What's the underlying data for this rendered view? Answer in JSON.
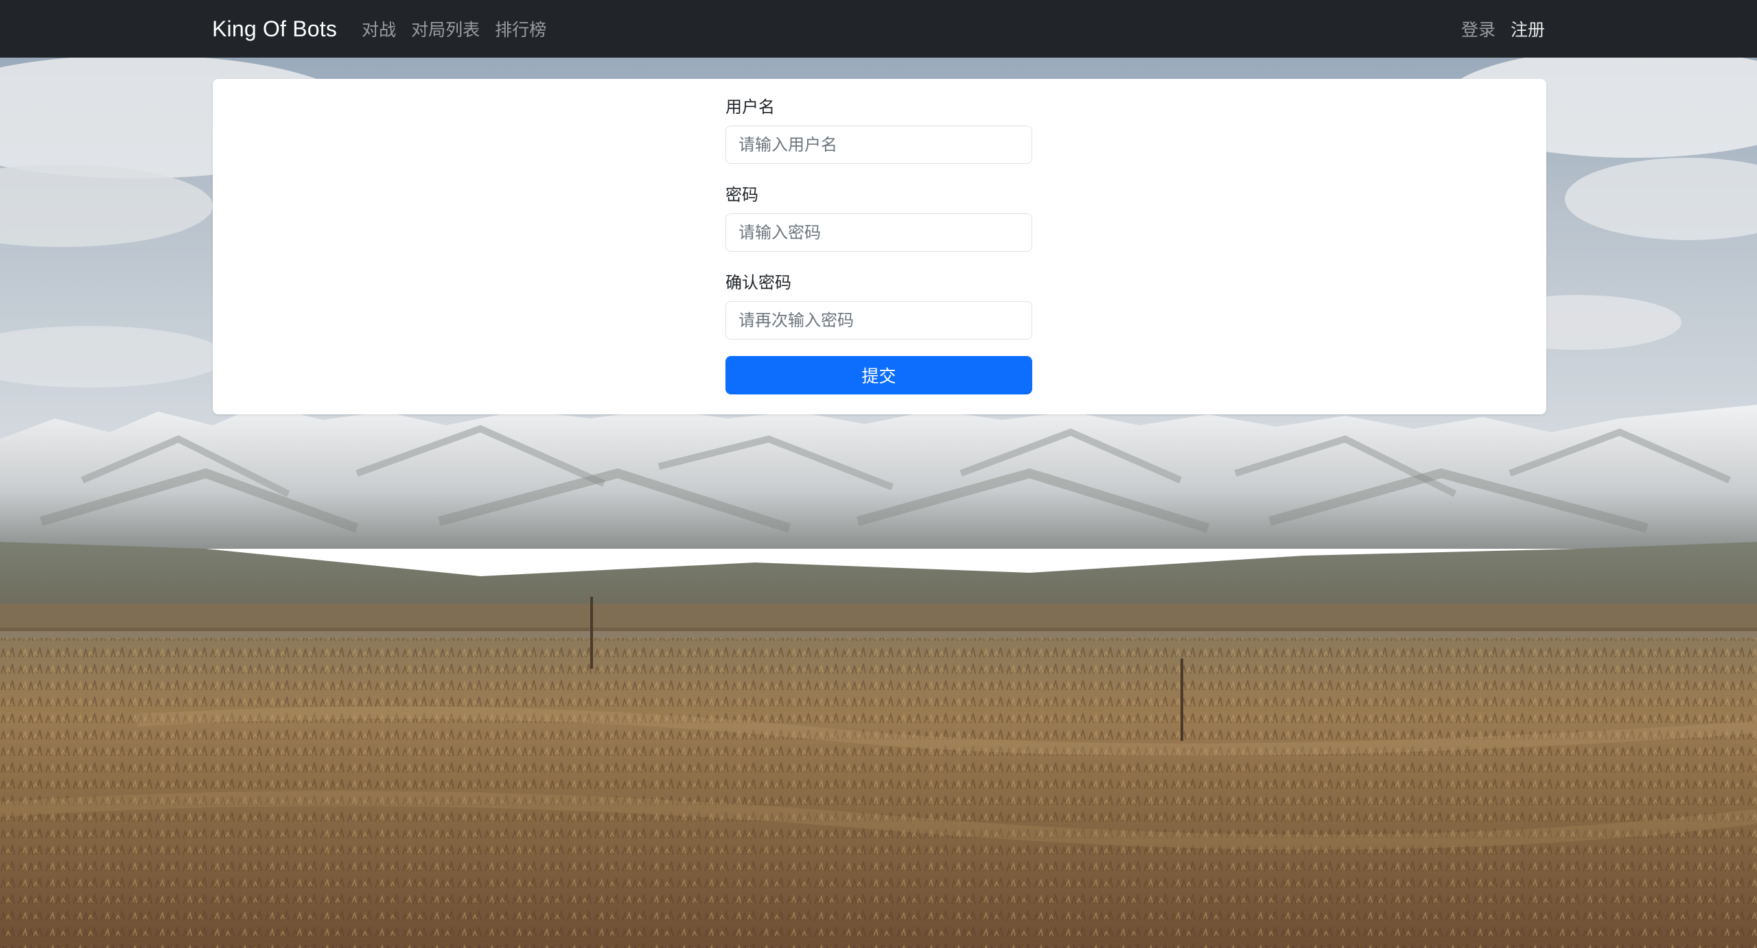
{
  "navbar": {
    "brand": "King Of Bots",
    "links": [
      {
        "label": "对战"
      },
      {
        "label": "对局列表"
      },
      {
        "label": "排行榜"
      }
    ],
    "login_label": "登录",
    "register_label": "注册"
  },
  "register_form": {
    "username": {
      "label": "用户名",
      "placeholder": "请输入用户名",
      "value": ""
    },
    "password": {
      "label": "密码",
      "placeholder": "请输入密码",
      "value": ""
    },
    "confirm_password": {
      "label": "确认密码",
      "placeholder": "请再次输入密码",
      "value": ""
    },
    "submit_label": "提交"
  },
  "colors": {
    "navbar_bg": "#212529",
    "primary": "#0d6efd",
    "nav_link": "rgba(255,255,255,0.55)"
  },
  "background": {
    "description_icon": "landscape-photo"
  }
}
